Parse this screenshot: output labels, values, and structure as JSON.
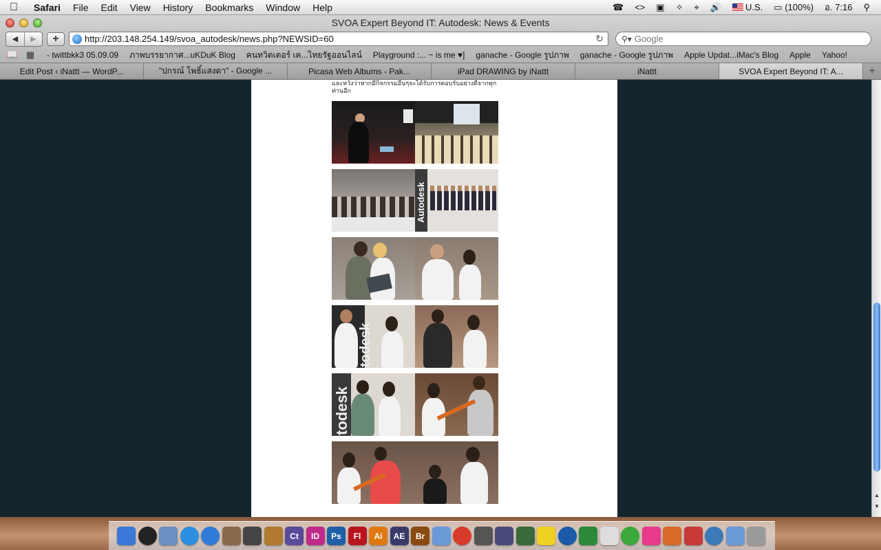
{
  "menubar": {
    "apple_icon": "apple-logo",
    "app_name": "Safari",
    "menus": [
      "File",
      "Edit",
      "View",
      "History",
      "Bookmarks",
      "Window",
      "Help"
    ],
    "input_source": "U.S.",
    "battery": "(100%)",
    "clock": "อ. 7:16"
  },
  "window": {
    "title": "SVOA Expert Beyond IT: Autodesk: News & Events"
  },
  "toolbar": {
    "url": "http://203.148.254.149/svoa_autodesk/news.php?NEWSID=60",
    "search_placeholder": "Google",
    "add_label": "+",
    "reload_label": "↻"
  },
  "bookmarks": [
    "- twittbkk3 05.09.09",
    "ภาพบรรยากาศ...uKDuK Blog",
    "คนทวิตเตอร์ เค...ไทยรัฐออนไลน์",
    "Playground :... ~ is me ♥]",
    "ganache - Google รูปภาพ",
    "ganache - Google รูปภาพ",
    "Apple Updat...iMac's Blog",
    "Apple",
    "Yahoo!"
  ],
  "tabs": [
    {
      "label": "Edit Post ‹ iNattt — WordP...",
      "active": false
    },
    {
      "label": "\"ปกรณ์ โพธิ์แสงดา\" - Google ...",
      "active": false
    },
    {
      "label": "Picasa Web Albums - Pak...",
      "active": false
    },
    {
      "label": "iPad DRAWING by iNattt",
      "active": false
    },
    {
      "label": "iNattt",
      "active": false
    },
    {
      "label": "SVOA Expert Beyond IT: A...",
      "active": true
    }
  ],
  "page": {
    "thai_text_line1": "และหวังว่าหากมีกิจกรรมอื่นๆจะได้รับการตอบรับอย่างดีจากทุก",
    "thai_text_line2": "ท่านอีก",
    "photos": [
      {
        "name": "event-photo-1",
        "watermark": ""
      },
      {
        "name": "event-photo-2",
        "watermark": "Autodesk"
      },
      {
        "name": "event-photo-3",
        "watermark": ""
      },
      {
        "name": "event-photo-4",
        "watermark": "todesk"
      },
      {
        "name": "event-photo-5",
        "watermark": "todesk"
      },
      {
        "name": "event-photo-6",
        "watermark": ""
      }
    ]
  },
  "dock": {
    "apps": [
      {
        "icon": "finder-icon",
        "label": "",
        "color": "#3b78d8"
      },
      {
        "icon": "dashboard-icon",
        "label": "",
        "color": "#222222"
      },
      {
        "icon": "preview-icon",
        "label": "",
        "color": "#6a8fc0"
      },
      {
        "icon": "safari-icon",
        "label": "",
        "color": "#2a8fe0"
      },
      {
        "icon": "itunes-icon",
        "label": "",
        "color": "#2f7bd8"
      },
      {
        "icon": "iphoto-icon",
        "label": "",
        "color": "#8a6a4a"
      },
      {
        "icon": "imovie-icon",
        "label": "",
        "color": "#444444"
      },
      {
        "icon": "garageband-icon",
        "label": "",
        "color": "#b07a30"
      },
      {
        "icon": "contribute-icon",
        "label": "Ct",
        "color": "#5a4a9a"
      },
      {
        "icon": "indesign-icon",
        "label": "ID",
        "color": "#c02a8a"
      },
      {
        "icon": "photoshop-icon",
        "label": "Ps",
        "color": "#1f5fa8"
      },
      {
        "icon": "flash-icon",
        "label": "Fl",
        "color": "#b8141e"
      },
      {
        "icon": "illustrator-icon",
        "label": "Ai",
        "color": "#e07a10"
      },
      {
        "icon": "aftereffects-icon",
        "label": "AE",
        "color": "#3a3a6a"
      },
      {
        "icon": "bridge-icon",
        "label": "Br",
        "color": "#8a4a10"
      },
      {
        "icon": "sketch-icon",
        "label": "",
        "color": "#6a9ad8"
      },
      {
        "icon": "chrome-icon",
        "label": "",
        "color": "#d83a2a"
      },
      {
        "icon": "photo-booth-icon",
        "label": "",
        "color": "#555555"
      },
      {
        "icon": "brush-icon",
        "label": "",
        "color": "#4a4a7a"
      },
      {
        "icon": "paint-icon",
        "label": "",
        "color": "#3a6a3a"
      },
      {
        "icon": "twitter-bird-icon",
        "label": "",
        "color": "#f0d020"
      },
      {
        "icon": "globe-icon",
        "label": "",
        "color": "#1a5aa8"
      },
      {
        "icon": "fruit-icon",
        "label": "",
        "color": "#2a8a3a"
      },
      {
        "icon": "textedit-icon",
        "label": "",
        "color": "#dddddd"
      },
      {
        "icon": "picasa-icon",
        "label": "",
        "color": "#3aa83a"
      },
      {
        "icon": "comic-life-icon",
        "label": "",
        "color": "#e83a8a"
      },
      {
        "icon": "pixel-icon",
        "label": "",
        "color": "#d86a2a"
      },
      {
        "icon": "pencil-icon",
        "label": "",
        "color": "#c83a3a"
      },
      {
        "icon": "utility-icon",
        "label": "",
        "color": "#3a7ab8"
      },
      {
        "icon": "documents-folder-icon",
        "label": "",
        "color": "#6a9ad8"
      },
      {
        "icon": "trash-icon",
        "label": "",
        "color": "#9a9a9a"
      }
    ]
  }
}
